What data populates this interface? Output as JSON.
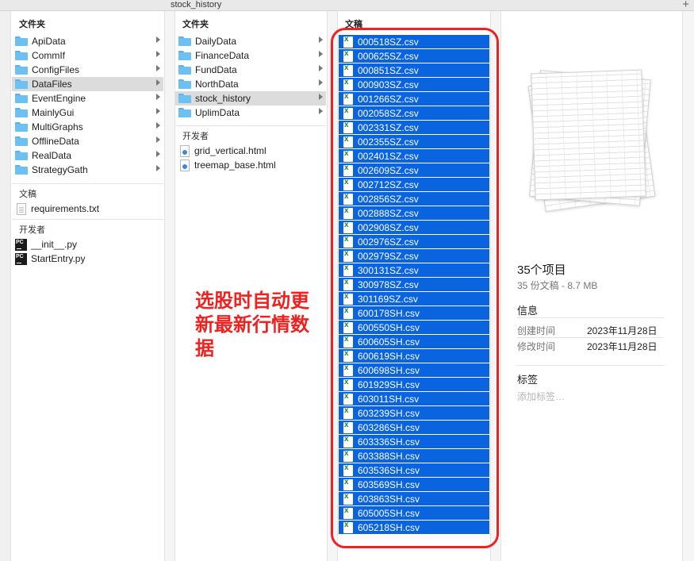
{
  "window": {
    "title": "stock_history"
  },
  "col1": {
    "header": "文件夹",
    "folders": [
      "ApiData",
      "CommIf",
      "ConfigFiles",
      "DataFiles",
      "EventEngine",
      "MainlyGui",
      "MultiGraphs",
      "OfflineData",
      "RealData",
      "StrategyGath"
    ],
    "docs_header": "文稿",
    "docs": [
      "requirements.txt"
    ],
    "dev_header": "开发者",
    "dev": [
      "__init__.py",
      "StartEntry.py"
    ]
  },
  "col2": {
    "header": "文件夹",
    "folders": [
      "DailyData",
      "FinanceData",
      "FundData",
      "NorthData",
      "stock_history",
      "UplimData"
    ],
    "dev_header": "开发者",
    "dev": [
      "grid_vertical.html",
      "treemap_base.html"
    ]
  },
  "col3": {
    "header": "文稿",
    "files": [
      "000518SZ.csv",
      "000625SZ.csv",
      "000851SZ.csv",
      "000903SZ.csv",
      "001266SZ.csv",
      "002058SZ.csv",
      "002331SZ.csv",
      "002355SZ.csv",
      "002401SZ.csv",
      "002609SZ.csv",
      "002712SZ.csv",
      "002856SZ.csv",
      "002888SZ.csv",
      "002908SZ.csv",
      "002976SZ.csv",
      "002979SZ.csv",
      "300131SZ.csv",
      "300978SZ.csv",
      "301169SZ.csv",
      "600178SH.csv",
      "600550SH.csv",
      "600605SH.csv",
      "600619SH.csv",
      "600698SH.csv",
      "601929SH.csv",
      "603011SH.csv",
      "603239SH.csv",
      "603286SH.csv",
      "603336SH.csv",
      "603388SH.csv",
      "603536SH.csv",
      "603569SH.csv",
      "603863SH.csv",
      "605005SH.csv",
      "605218SH.csv"
    ]
  },
  "annotation": {
    "text": "选股时自动更新最新行情数据",
    "color": "#f0211f"
  },
  "info": {
    "count_title": "35个项目",
    "count_sub": "35 份文稿 - 8.7 MB",
    "section_info": "信息",
    "created_label": "创建时间",
    "created_value": "2023年11月28日",
    "modified_label": "修改时间",
    "modified_value": "2023年11月28日",
    "section_tags": "标签",
    "tags_placeholder": "添加标签…"
  },
  "colors": {
    "selection": "#0a64e0",
    "folder": "#6cc0f2",
    "highlight_box": "#f0211f"
  }
}
